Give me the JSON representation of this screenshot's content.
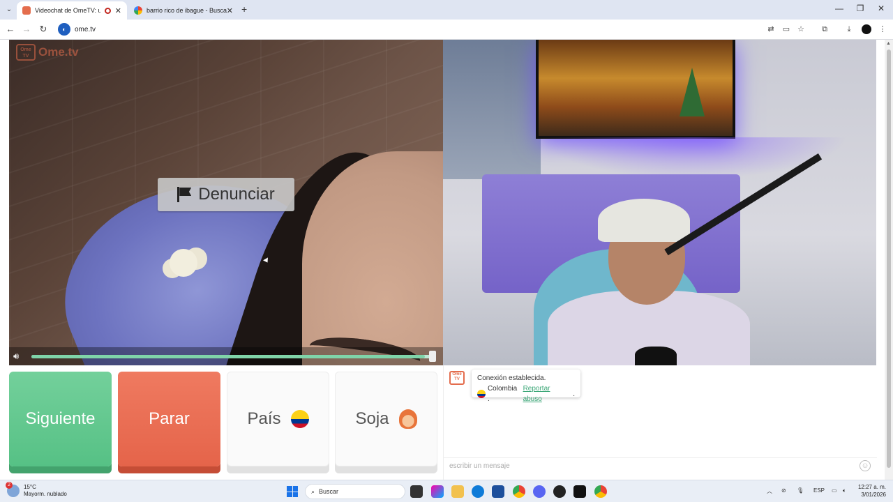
{
  "browser": {
    "tabs": [
      {
        "title": "Videochat de OmeTV: una",
        "active": true
      },
      {
        "title": "barrio rico de ibague - Buscar c",
        "active": false
      }
    ],
    "url": "ome.tv",
    "window_controls": {
      "minimize": "—",
      "restore": "❐",
      "close": "✕"
    }
  },
  "site": {
    "logo_text": "Ome.tv",
    "logo_box_text": "Ome TV",
    "report_button_label": "Denunciar",
    "volume_level": 0.98
  },
  "controls": {
    "next_label": "Siguiente",
    "stop_label": "Parar",
    "country_label": "País",
    "gender_label": "Soja"
  },
  "chat": {
    "logo_box_text": "Ome TV",
    "status": "Conexión establecida.",
    "country": "Colombia .",
    "report_abuse": "Reportar abuso",
    "report_suffix": ".",
    "input_placeholder": "escribir un mensaje"
  },
  "taskbar": {
    "weather_temp": "15°C",
    "weather_desc": "Mayorm. nublado",
    "weather_badge": "2",
    "search_placeholder": "Buscar",
    "language": "ESP",
    "time": "12:27 a. m.",
    "date": "3/01/2026"
  },
  "colors": {
    "next": "#56c185",
    "stop": "#e5644a",
    "accent_link": "#3aa676",
    "brand": "#e46d4d"
  }
}
